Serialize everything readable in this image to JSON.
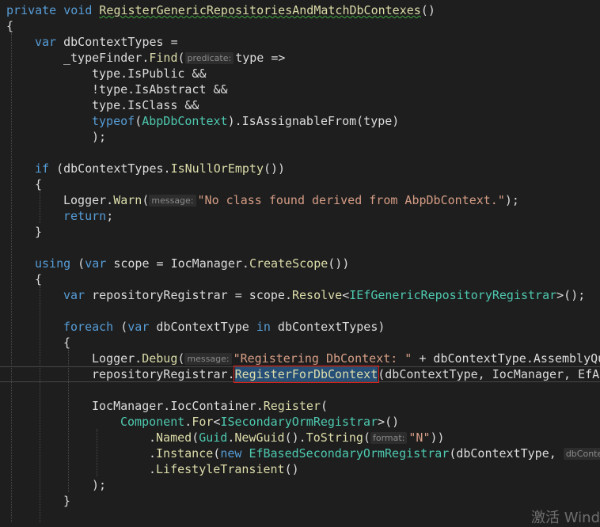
{
  "editor": {
    "header_line": {
      "kw_private": "private",
      "kw_void": "void",
      "method_name": "RegisterGenericRepositoriesAndMatchDbContexes",
      "parens": "()"
    },
    "lines": {
      "open_brace_1": "{",
      "l_var": "var",
      "l_dbContextTypes_decl": "dbContextTypes =",
      "l_typeFinder": "_typeFinder",
      "l_find": "Find",
      "l_find_paren": "(",
      "hint_predicate": "predicate:",
      "l_type_arrow": "type =>",
      "l_isPublic_type": "type",
      "l_isPublic_rest": ".IsPublic &&",
      "l_not": "!",
      "l_isAbstract_rest": "type.IsAbstract &&",
      "l_isClass_rest": "type.IsClass &&",
      "l_typeof": "typeof",
      "l_abp_open": "(",
      "l_AbpDbContext": "AbpDbContext",
      "l_isAssignable": ").IsAssignableFrom(type)",
      "l_close_find": ");",
      "l_if": "if",
      "l_if_rest_1": " (dbContextTypes.",
      "l_isNullOrEmpty": "IsNullOrEmpty",
      "l_if_rest_2": "())",
      "open_brace_2": "{",
      "l_logger_warn_1": "Logger.",
      "l_warn": "Warn",
      "l_paren_open": "(",
      "hint_message_1": "message:",
      "l_warn_str": "\"No class found derived from AbpDbContext.\"",
      "l_close_semicolon": ");",
      "l_return": "return",
      "l_semicolon": ";",
      "close_brace_2": "}",
      "l_using": "using",
      "l_using_open": " (",
      "l_using_var": "var",
      "l_using_rest_1": " scope = IocManager.",
      "l_createScope": "CreateScope",
      "l_using_rest_2": "())",
      "open_brace_3": "{",
      "l_var2": "var",
      "l_repoReg_rest_1": " repositoryRegistrar = scope.",
      "l_resolve": "Resolve",
      "l_lt": "<",
      "l_IEfGeneric": "IEfGenericRepositoryRegistrar",
      "l_gt_end": ">();",
      "l_foreach": "foreach",
      "l_foreach_open": " (",
      "l_var3": "var",
      "l_foreach_mid": " dbContextType ",
      "l_in": "in",
      "l_foreach_end": " dbContextTypes)",
      "open_brace_4": "{",
      "l_logger_debug_1": "Logger.",
      "l_debug": "Debug",
      "hint_message_2": "message:",
      "l_debug_str": "\"Registering DbContext: \"",
      "l_debug_rest": " + dbContextType.AssemblyQu",
      "l_repoReg_call": "repositoryRegistrar.",
      "l_registerForDbContext": "RegisterForDbContext",
      "l_register_args": "(dbContextType, IocManager, EfAu",
      "l_ioc_register_1": "IocManager.IocContainer.",
      "l_register": "Register",
      "l_register_open": "(",
      "l_component": "Component",
      "l_dot": ".",
      "l_for": "For",
      "l_lt2": "<",
      "l_ISecondary": "ISecondaryOrmRegistrar",
      "l_gt_paren": ">()",
      "l_dot_named": ".",
      "l_named": "Named",
      "l_named_open": "(",
      "l_guid": "Guid",
      "l_newGuid": "NewGuid",
      "l_toString": "ToString",
      "hint_format": "format:",
      "l_n_str": "\"N\"",
      "l_named_close": "))",
      "l_dot_instance": ".",
      "l_instance": "Instance",
      "l_instance_open": "(",
      "l_new": "new",
      "l_EfBased": "EfBasedSecondaryOrmRegistrar",
      "l_instance_args": "(dbContextType, ",
      "hint_dbConte": "dbConte",
      "l_dot_lifestyle": ".",
      "l_lifestyle": "LifestyleTransient",
      "l_lifestyle_paren": "()",
      "l_close_register": ");",
      "close_brace_4": "}"
    },
    "colors": {
      "background": "#1e1e1e",
      "keyword": "#569cd6",
      "type": "#4ec9b0",
      "method": "#dcdcaa",
      "string": "#d69d85",
      "identifier": "#dcdcdc",
      "selection": "#264f78",
      "selection_box": "#e02020"
    },
    "watermark": "激活 Wind"
  }
}
